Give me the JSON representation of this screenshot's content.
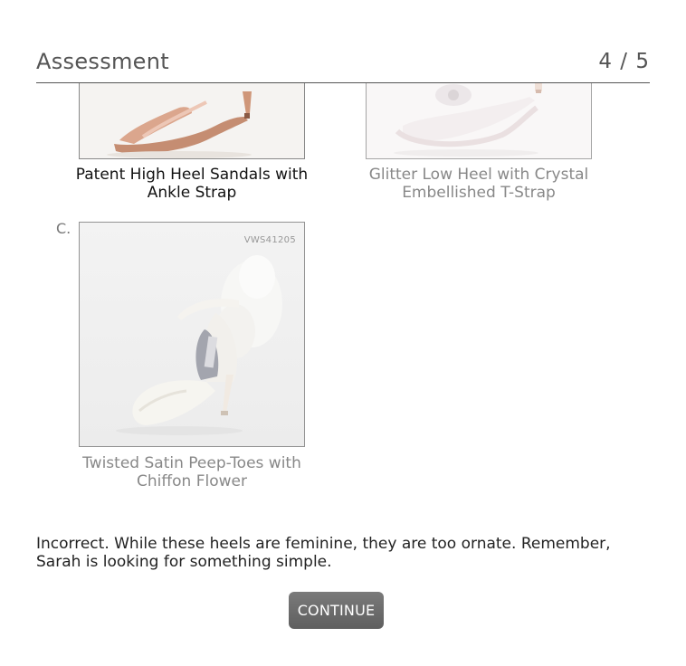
{
  "header": {
    "title": "Assessment",
    "progress": "4 / 5"
  },
  "options": [
    {
      "caption": "Patent High Heel Sandals with Ankle Strap",
      "state": "selected"
    },
    {
      "caption": "Glitter Low Heel with Crystal Embellished T-Strap",
      "state": "unselected"
    },
    {
      "letter": "C.",
      "caption": "Twisted Satin Peep-Toes with Chiffon Flower",
      "sku": "VWS41205",
      "state": "unselected"
    }
  ],
  "feedback": {
    "text": "Incorrect. While these heels are feminine, they are too ornate. Remember, Sarah is looking for something simple."
  },
  "continue_button": {
    "label": "CONTINUE"
  },
  "colors": {
    "button": "#6b6b6b",
    "rule": "#555555",
    "caption_dim": "#888888",
    "shoe_patent": "#d9a58c",
    "shoe_ivory": "#f3f1ec"
  }
}
